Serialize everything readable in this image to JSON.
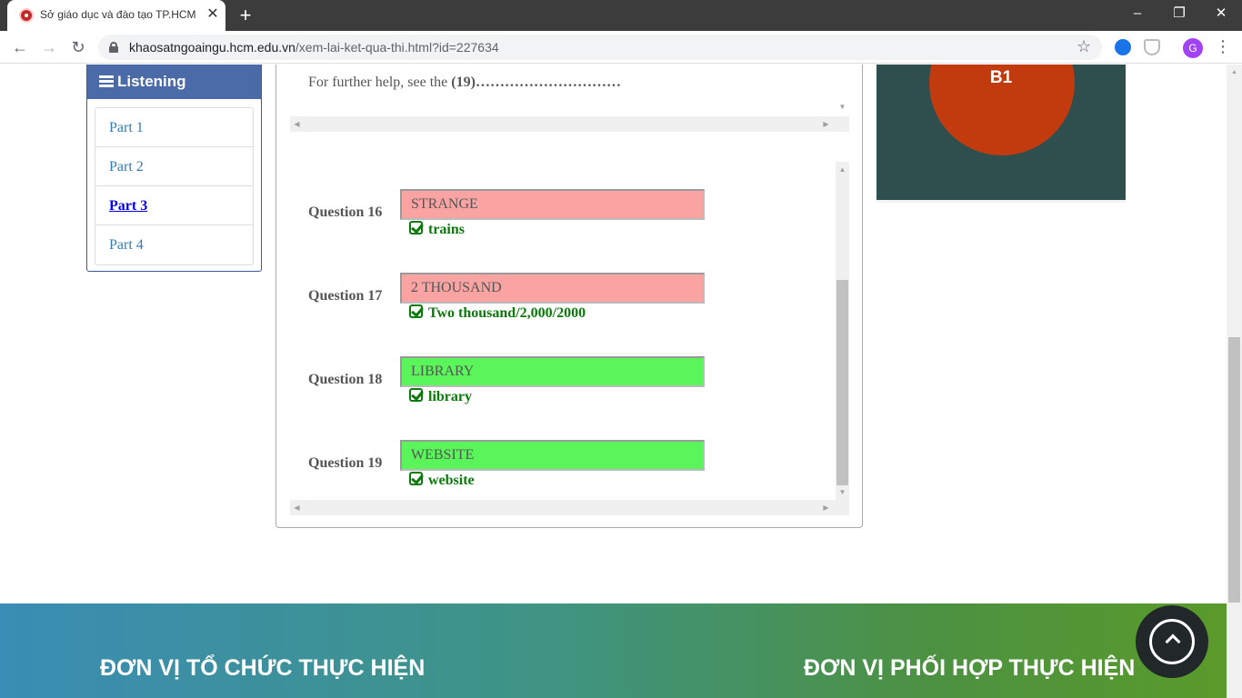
{
  "browser": {
    "tab_title": "Sở giáo dục và đào tạo TP.HCM",
    "tab_close": "✕",
    "new_tab": "+",
    "url_host": "khaosatngoaingu.hcm.edu.vn",
    "url_path": "/xem-lai-ket-qua-thi.html?id=227634",
    "avatar_letter": "G",
    "window_controls": {
      "minimize": "–",
      "restore": "❐",
      "close": "✕"
    },
    "nav": {
      "back": "←",
      "forward": "→",
      "reload": "↻"
    },
    "star": "☆",
    "menu": "⋮"
  },
  "sidebar": {
    "title": "Listening",
    "items": [
      {
        "label": "Part 1",
        "active": false
      },
      {
        "label": "Part 2",
        "active": false
      },
      {
        "label": "Part 3",
        "active": true
      },
      {
        "label": "Part 4",
        "active": false
      }
    ]
  },
  "passage": {
    "text_prefix": "For further help, see the ",
    "blank_number": "(19)",
    "blank_dots": "…………………………"
  },
  "questions": [
    {
      "label": "Question 16",
      "answer": "STRANGE",
      "status": "wrong",
      "correct": "trains"
    },
    {
      "label": "Question 17",
      "answer": "2 THOUSAND",
      "status": "wrong",
      "correct": "Two thousand/2,000/2000"
    },
    {
      "label": "Question 18",
      "answer": "LIBRARY",
      "status": "right",
      "correct": "library"
    },
    {
      "label": "Question 19",
      "answer": "WEBSITE",
      "status": "right",
      "correct": "website"
    }
  ],
  "score": {
    "level": "B1"
  },
  "footer": {
    "left_heading": "ĐƠN VỊ TỔ CHỨC THỰC HIỆN",
    "right_heading": "ĐƠN VỊ PHỐI HỢP THỰC HIỆN"
  },
  "colors": {
    "sidebar_header": "#4a6aa8",
    "wrong_answer": "#f9a3a3",
    "right_answer": "#5af55a",
    "correct_text": "#0a7a0a",
    "score_card": "#2f4f4f",
    "score_circle": "#c23b0f"
  }
}
